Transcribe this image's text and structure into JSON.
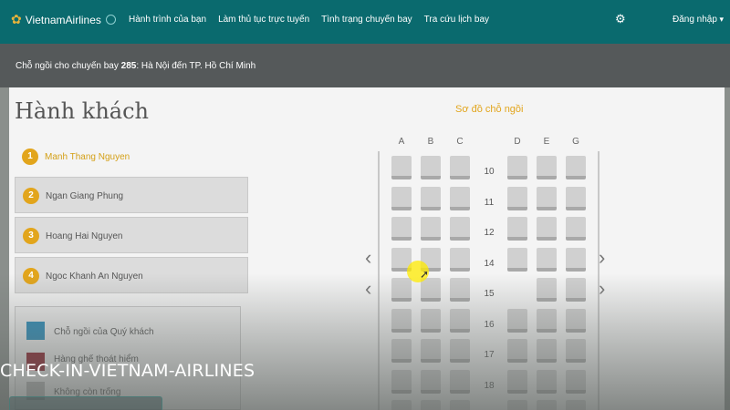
{
  "header": {
    "logo_text": "VietnamAirlines",
    "nav": [
      "Hành trình của bạn",
      "Làm thủ tục trực tuyến",
      "Tình trạng chuyến bay",
      "Tra cứu lịch bay"
    ],
    "settings_icon": "gear-icon",
    "login_label": "Đăng nhập"
  },
  "flight": {
    "prefix": "Chỗ ngồi cho chuyến bay ",
    "number": "285",
    "route": ": Hà Nội đến TP. Hồ Chí Minh"
  },
  "passengers_title": "Hành khách",
  "passengers": [
    {
      "num": "1",
      "name": "Manh Thang Nguyen",
      "active": true
    },
    {
      "num": "2",
      "name": "Ngan Giang Phung",
      "active": false
    },
    {
      "num": "3",
      "name": "Hoang Hai Nguyen",
      "active": false
    },
    {
      "num": "4",
      "name": "Ngoc Khanh An Nguyen",
      "active": false
    }
  ],
  "legend": [
    {
      "label": "Chỗ ngồi của Quý khách",
      "color": "#2a8bb8"
    },
    {
      "label": "Hàng ghế thoát hiểm",
      "color": "#8b1e2a"
    },
    {
      "label": "Không còn trống",
      "color": "#b5b5b5"
    }
  ],
  "seatmap": {
    "title": "Sơ đồ chỗ ngồi",
    "columns_left": [
      "A",
      "B",
      "C"
    ],
    "columns_right": [
      "D",
      "E",
      "G"
    ],
    "rows": [
      {
        "num": "10",
        "seats": [
          1,
          1,
          1,
          1,
          1,
          1
        ]
      },
      {
        "num": "11",
        "seats": [
          1,
          1,
          1,
          1,
          1,
          1
        ]
      },
      {
        "num": "12",
        "seats": [
          1,
          1,
          1,
          1,
          1,
          1
        ]
      },
      {
        "num": "14",
        "seats": [
          1,
          1,
          1,
          1,
          1,
          1
        ]
      },
      {
        "num": "15",
        "seats": [
          1,
          1,
          1,
          0,
          1,
          1
        ]
      },
      {
        "num": "16",
        "seats": [
          1,
          1,
          1,
          1,
          1,
          1
        ]
      },
      {
        "num": "17",
        "seats": [
          1,
          1,
          1,
          1,
          1,
          1
        ]
      },
      {
        "num": "18",
        "seats": [
          1,
          1,
          1,
          1,
          1,
          1
        ]
      },
      {
        "num": "",
        "seats": [
          1,
          1,
          1,
          1,
          1,
          1
        ]
      }
    ]
  },
  "watermark": "CHECK-IN-VIETNAM-AIRLINES",
  "colors": {
    "brand": "#0a6a6e",
    "accent": "#e2a51c"
  }
}
